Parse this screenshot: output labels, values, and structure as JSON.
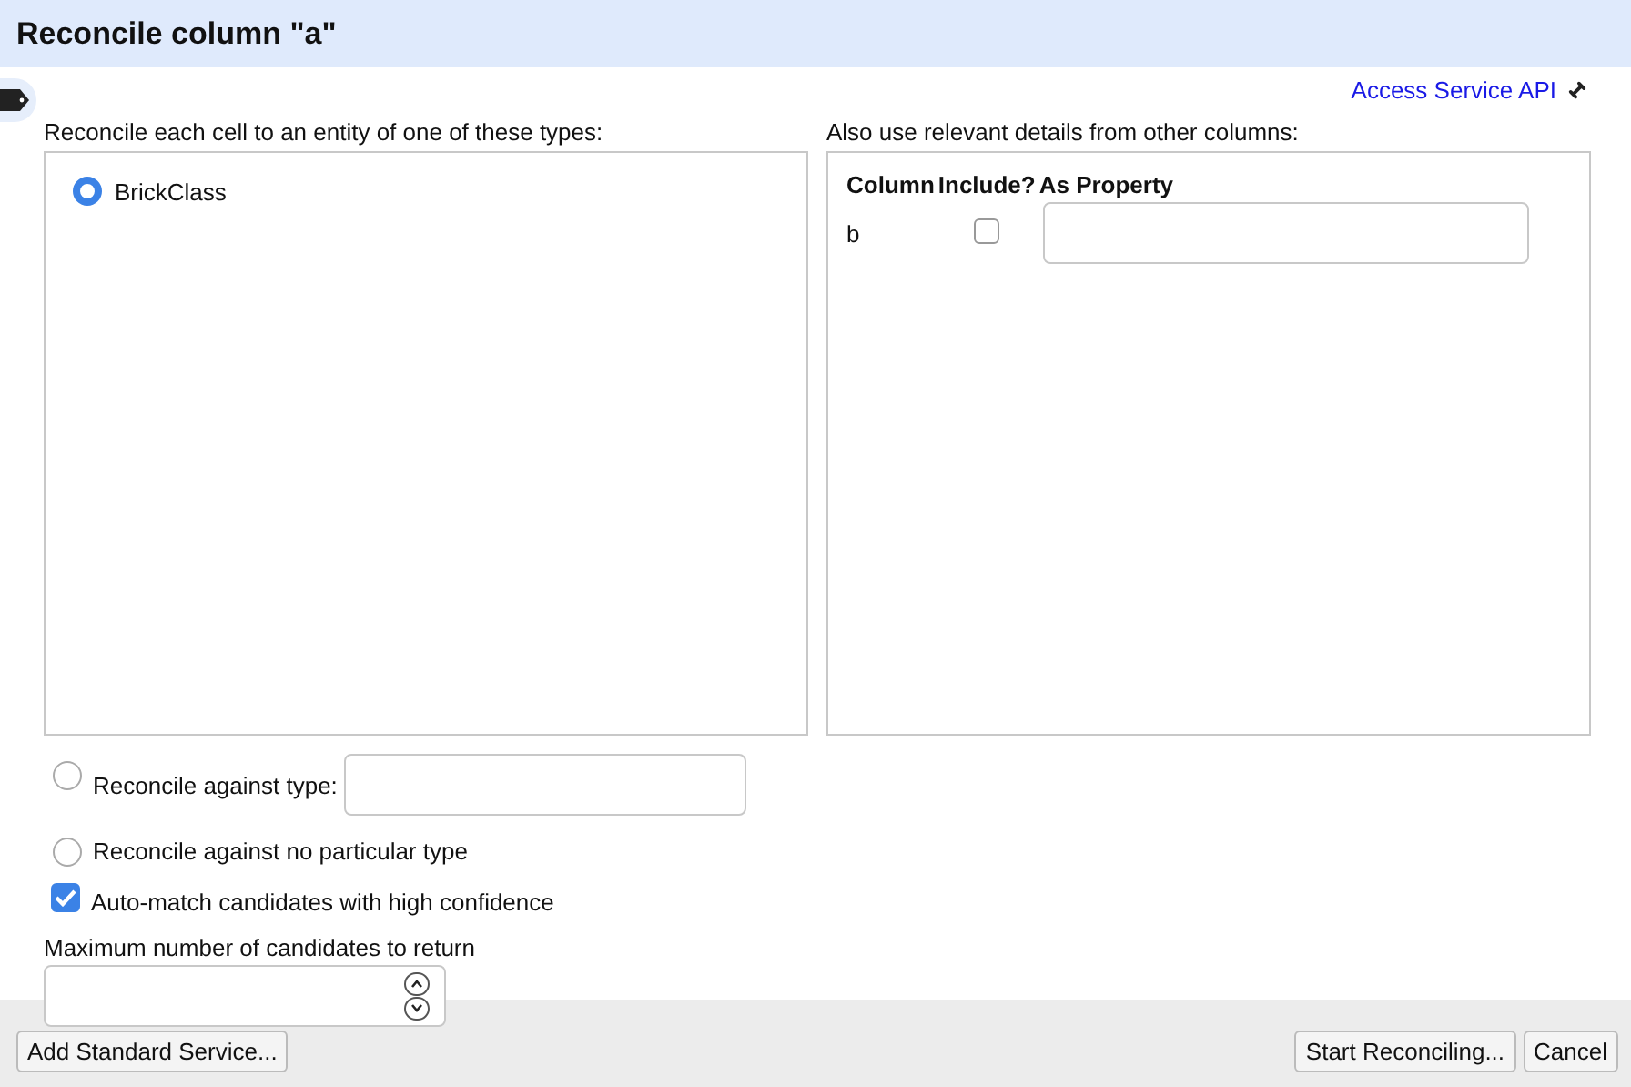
{
  "dialog": {
    "title": "Reconcile column \"a\""
  },
  "service_link": {
    "label": "Access Service API"
  },
  "types": {
    "label": "Reconcile each cell to an entity of one of these types:",
    "options": [
      {
        "label": "BrickClass",
        "selected": true
      }
    ]
  },
  "details": {
    "label": "Also use relevant details from other columns:",
    "columns": [
      "Column",
      "Include?",
      "As Property"
    ],
    "rows": [
      {
        "column": "b",
        "include": false
      }
    ]
  },
  "type_options": [
    {
      "kind": "field",
      "label": "Reconcile against type:",
      "selected": false
    },
    {
      "kind": "plain",
      "label": "Reconcile against no particular type",
      "selected": false
    }
  ],
  "auto_match": {
    "label": "Auto-match candidates with high confidence",
    "checked": true
  },
  "max_candidates": {
    "label": "Maximum number of candidates to return"
  },
  "buttons": {
    "left": "Add Standard Service...",
    "right": [
      "Start Reconciling...",
      "Cancel"
    ]
  }
}
